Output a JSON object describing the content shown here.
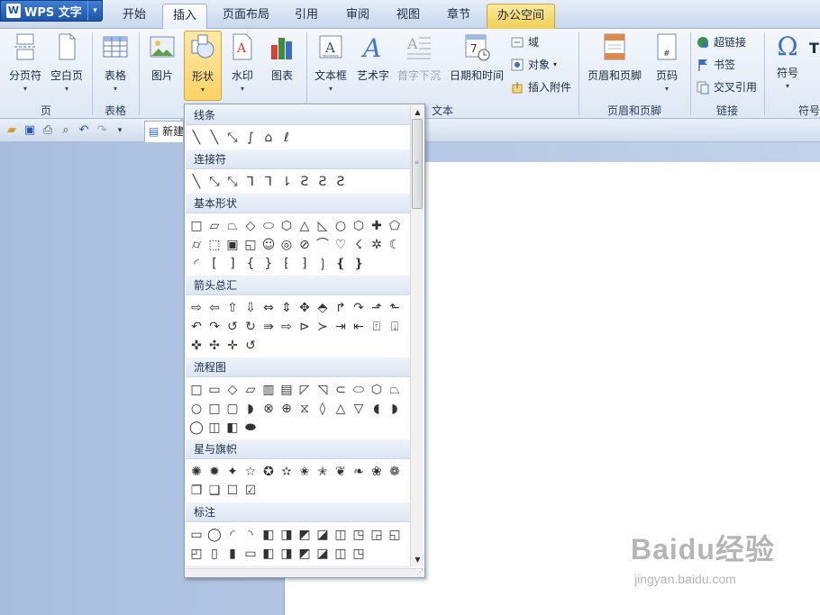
{
  "app": {
    "title": "WPS 文字",
    "logo_letter": "W",
    "menu_arrow": "▾"
  },
  "tabs": [
    "开始",
    "插入",
    "页面布局",
    "引用",
    "审阅",
    "视图",
    "章节",
    "办公空间"
  ],
  "active_tab": "插入",
  "ribbon": {
    "buttons": [
      {
        "label": "分页符",
        "icon": "page-break-icon",
        "dropdown": "▾"
      },
      {
        "label": "空白页",
        "icon": "blank-page-icon",
        "dropdown": "▾"
      },
      {
        "label": "表格",
        "icon": "table-icon",
        "dropdown": "▾"
      },
      {
        "label": "图片",
        "icon": "picture-icon"
      },
      {
        "label": "形状",
        "icon": "shapes-icon",
        "dropdown": "▾"
      },
      {
        "label": "水印",
        "icon": "watermark-icon",
        "dropdown": "▾"
      },
      {
        "label": "图表",
        "icon": "chart-icon"
      },
      {
        "label": "文本框",
        "icon": "textbox-icon",
        "dropdown": "▾"
      },
      {
        "label": "艺术字",
        "icon": "wordart-icon"
      },
      {
        "label": "首字下沉",
        "icon": "dropcap-icon"
      },
      {
        "label": "日期和时间",
        "icon": "datetime-icon"
      },
      {
        "label": "页眉和页脚",
        "icon": "header-footer-icon"
      },
      {
        "label": "页码",
        "icon": "page-number-icon",
        "dropdown": "▾"
      },
      {
        "label": "符号",
        "icon": "omega-icon",
        "dropdown": "▾"
      }
    ],
    "small_buttons": [
      {
        "label": "域",
        "icon": "field-icon"
      },
      {
        "label": "对象",
        "icon": "object-icon",
        "dropdown": "▾"
      },
      {
        "label": "插入附件",
        "icon": "attachment-icon"
      },
      {
        "label": "超链接",
        "icon": "hyperlink-icon"
      },
      {
        "label": "书签",
        "icon": "bookmark-icon"
      },
      {
        "label": "交叉引用",
        "icon": "cross-reference-icon"
      }
    ],
    "groups": [
      "页",
      "表格",
      "文本",
      "页眉和页脚",
      "链接",
      "符号"
    ],
    "cut_off_label": "T"
  },
  "document_tab": "新建",
  "shapes_panel": {
    "categories": [
      {
        "name": "线条",
        "shapes": [
          "╲",
          "╲",
          "⤡",
          "∫",
          "⌂",
          "ℓ"
        ]
      },
      {
        "name": "连接符",
        "shapes": [
          "╲",
          "⤡",
          "⤡",
          "⅂",
          "⅂",
          "⇂",
          "Ƨ",
          "Ƨ",
          "Ƨ"
        ]
      },
      {
        "name": "基本形状",
        "shapes": [
          "□",
          "▱",
          "⏢",
          "◇",
          "⬭",
          "⬡",
          "△",
          "◺",
          "○",
          "⬡",
          "✚",
          "⬠",
          "⌭",
          "⬚",
          "▣",
          "◱",
          "☺",
          "◎",
          "⊘",
          "⌒",
          "♡",
          "☇",
          "✲",
          "☾",
          "◜",
          "[",
          "]",
          "{",
          "}",
          "⁅",
          "⁆",
          "❳",
          "❴",
          "❵"
        ]
      },
      {
        "name": "箭头总汇",
        "shapes": [
          "⇨",
          "⇦",
          "⇧",
          "⇩",
          "⇔",
          "⇕",
          "✥",
          "⬘",
          "↱",
          "↷",
          "⬏",
          "⬑",
          "↶",
          "↷",
          "↺",
          "↻",
          "⇛",
          "⇨",
          "⊳",
          "≻",
          "⇥",
          "⇤",
          "⍐",
          "⍗",
          "✜",
          "✣",
          "✛",
          "↺"
        ]
      },
      {
        "name": "流程图",
        "shapes": [
          "□",
          "▭",
          "◇",
          "▱",
          "▥",
          "▤",
          "◸",
          "◹",
          "⊂",
          "⬭",
          "⬡",
          "⏢",
          "○",
          "□",
          "▢",
          "◗",
          "⊗",
          "⊕",
          "⧖",
          "◊",
          "△",
          "▽",
          "◖",
          "◗",
          "◯",
          "◫",
          "◧",
          "⬬"
        ]
      },
      {
        "name": "星与旗帜",
        "shapes": [
          "✺",
          "✹",
          "✦",
          "☆",
          "✪",
          "✫",
          "✬",
          "✭",
          "❦",
          "❧",
          "❀",
          "❁",
          "❐",
          "❑",
          "☐",
          "☑"
        ]
      },
      {
        "name": "标注",
        "shapes": [
          "▭",
          "◯",
          "◜",
          "◝",
          "◧",
          "◨",
          "◩",
          "◪",
          "◫",
          "◳",
          "◲",
          "◱",
          "◰",
          "▯",
          "▮",
          "▭",
          "◧",
          "◨",
          "◩",
          "◪",
          "◫",
          "◳"
        ]
      }
    ],
    "truncated_category": "…"
  },
  "watermark": {
    "logo": "Baidu经验",
    "url": "jingyan.baidu.com"
  }
}
